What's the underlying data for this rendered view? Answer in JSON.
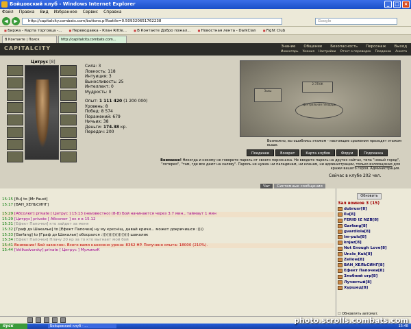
{
  "window": {
    "title": "Бойцовский клуб - Windows Internet Explorer"
  },
  "menu": [
    "Файл",
    "Правка",
    "Вид",
    "Избранное",
    "Сервис",
    "Справка"
  ],
  "address": {
    "url": "http://capitalcity.combats.com/buttons.pl?battle=0.509320651762238",
    "search_placeholder": "Google"
  },
  "favorites": [
    "Биржа - Карта торговца -...",
    "Переводавка - Клан Rittle...",
    "В Контакте  Добро пожал...",
    "Новостная лента - DarkClan",
    "Fight Club"
  ],
  "tabs": [
    "В Контакте | Поиск",
    "http://capitalcity.combats.com..."
  ],
  "game": {
    "logo": "CAPITALCITY",
    "nav": [
      "Знание",
      "Общение",
      "Безопасность",
      "Персонаж",
      "Выход"
    ],
    "subnav": [
      "Инвентарь",
      "Умения",
      "Настройки",
      "Отчет о переводах",
      "Поединки",
      "Анкета"
    ],
    "character": {
      "name": "Цитрус",
      "level": "[8]"
    },
    "stats": [
      "Сила: 3",
      "Ловкость: 118",
      "Интуиция: 3",
      "Выносливость: 25",
      "Интеллект: 0",
      "Мудрость: 0"
    ],
    "stats2": [
      "Уровень: 8",
      "Побед: 8 574",
      "Поражений: 679",
      "Ничьих: 38",
      "Передач: 200"
    ],
    "exp": "Опыт: ",
    "exp_val": "1 111 420",
    "exp_next": " (1 200 000)",
    "money": "Деньги: ",
    "money_val": "174.38",
    "money_unit": " кр.",
    "map_halls": [
      "Залы",
      "2 ЭТАЖ",
      "Центральная площадь"
    ],
    "map_note": "Возможно, вы ошиблись этажом - настоящие сражения проходят этажом выше.",
    "buttons": [
      "Поединки",
      "Возврат",
      "Карта клубов",
      "Форум",
      "Подсказка"
    ],
    "warning_bold": "Внимание!",
    "warning_text": " Никогда и никому не говорите пароль от своего персонажа. Не вводите пароль на других сайтах, типа \"новый город\", \"лотерея\", \"там, где все дают на халяву\". Пароль не нужен ни паладинам, ни кланам, ни администрации,",
    "warning_link": " только взломщикам",
    "warning_tail": " для кражи вашего героя. Администрация.",
    "online": "Сейчас в клубе 202 чел."
  },
  "chat": {
    "tabs": [
      "Чат",
      "Системные сообщения"
    ],
    "messages": [
      {
        "time": "15:15",
        "text": "[Eu] to [Mr Faust]"
      },
      {
        "time": "15:17",
        "text": "[ВАН_ХЕЛЬСИНГ]"
      },
      {
        "time": "15:29",
        "text": "[Абсолют] private [ Цитрус ] 15:13 (неизвестно) (8-8) Бой начинается через 3.7 мин., таймаут 1 мин"
      },
      {
        "time": "15:29",
        "text": "[Цитрус] private [ Абсолют ] ок я в 15.12"
      },
      {
        "time": "15:31",
        "text": "[Ефект Папочки] кто зайдет за меня"
      },
      {
        "time": "15:32",
        "text": "[Граф дэ Шакалье] to [Ефект Папочки] ну му крєсніщ, давай кричи... может докричишся :))))"
      },
      {
        "time": "15:33",
        "text": "[Garfang] to [Граф дэ Шакалье] обосрался :)))))))))))))))))) шакалик"
      },
      {
        "time": "15:34",
        "text": "[Ефект Папочки] Плачу 20 кр за то кто выгнает мой бой"
      },
      {
        "time": "15:41",
        "text": "Внимание! Бой закончен. Всего вами нанесено урона: 8362 HP. Получено опыта: 18000 (210%)."
      },
      {
        "time": "15:44",
        "text": "[Velikodvorsky] private [ Цитрус ] МужикиК"
      }
    ]
  },
  "players": {
    "refresh": "Обновить",
    "title": "Зал воинов 3 (15)",
    "list": [
      "dubrusr[8]",
      "Eu[8]",
      "FERID IZ NZB[8]",
      "Garfang[8]",
      "gvardiola[8]",
      "Im-pulo[8]",
      "knjaz[8]",
      "Not Enough Love[8]",
      "Uncle_Kuk[8]",
      "Zellow[8]",
      "ВАН_ХЕЛЬСИНГ[8]",
      "Ефект Папочки[8]",
      "Злобний огр[8]",
      "Лучистый[8]",
      "Хуршед[8]"
    ],
    "auto": "Обновлять автомат."
  },
  "taskbar": {
    "start": "пуск",
    "item": "Бойцовский клуб - ...",
    "clock": "15:48"
  },
  "watermark": "photo.scrolls.combats.com"
}
